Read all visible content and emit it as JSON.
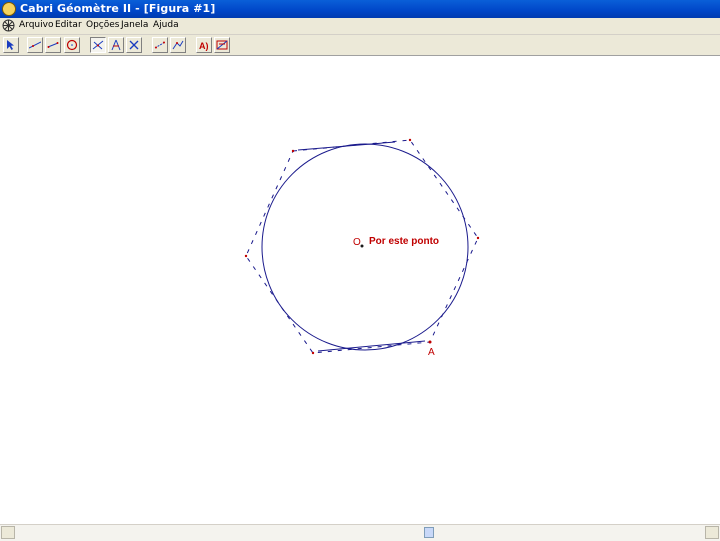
{
  "window": {
    "title": "Cabri Géomètre II - [Figura #1]"
  },
  "menu": {
    "items": [
      "Arquivo",
      "Editar",
      "Opções",
      "Janela",
      "Ajuda"
    ]
  },
  "toolbar": {
    "tools": [
      "pointer-icon",
      "line-icon",
      "segment-icon",
      "circle-icon",
      "point-on-object-icon",
      "perpendicular-icon",
      "transformation-icon",
      "measure-icon",
      "check-property-icon",
      "text-label-icon",
      "display-icon"
    ]
  },
  "figure": {
    "label_o": "O",
    "annotation": "Por este ponto",
    "label_a": "A",
    "colors": {
      "construction": "#1a1a8c",
      "labels": "#c00000"
    }
  }
}
